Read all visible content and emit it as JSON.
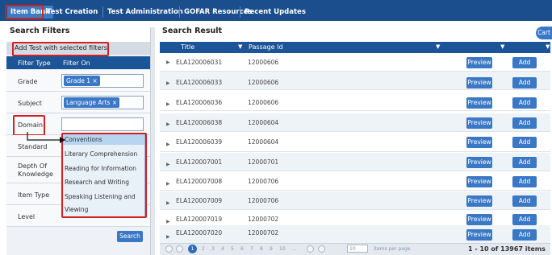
{
  "nav": {
    "items": [
      {
        "label": "Item Bank"
      },
      {
        "label": "Test Creation"
      },
      {
        "label": "Test Administration"
      },
      {
        "label": "GOFAR Resources"
      },
      {
        "label": "Recent Updates"
      }
    ]
  },
  "filters": {
    "title": "Search Filters",
    "add_test_label": "Add Test with selected filters",
    "col_filter_type": "Filter Type",
    "col_filter_on": "Filter On",
    "rows": [
      {
        "label": "Grade",
        "chip": "Grade 1 ×"
      },
      {
        "label": "Subject",
        "chip": "Language Arts ×"
      },
      {
        "label": "Domain"
      },
      {
        "label": "Standard"
      },
      {
        "label": "Depth Of Knowledge"
      },
      {
        "label": "Item Type"
      },
      {
        "label": "Level"
      }
    ],
    "domain_options": [
      "Conventions",
      "Literary Comprehension",
      "Reading for Information",
      "Research and Writing",
      "Speaking Listening and",
      "Viewing"
    ],
    "search_label": "Search"
  },
  "results": {
    "title": "Search Result",
    "cart_label": "Cart",
    "col_title": "Title",
    "col_passage": "Passage Id",
    "preview_label": "Preview",
    "add_label": "Add",
    "rows": [
      {
        "title": "ELA120006031",
        "passage": "12000606"
      },
      {
        "title": "ELA120006033",
        "passage": "12000606"
      },
      {
        "title": "ELA120006036",
        "passage": "12000606"
      },
      {
        "title": "ELA120006038",
        "passage": "12000604"
      },
      {
        "title": "ELA120006039",
        "passage": "12000604"
      },
      {
        "title": "ELA120007001",
        "passage": "12000701"
      },
      {
        "title": "ELA120007008",
        "passage": "12000706"
      },
      {
        "title": "ELA120007009",
        "passage": "12000706"
      },
      {
        "title": "ELA120007019",
        "passage": "12000702"
      },
      {
        "title": "ELA120007020",
        "passage": "12000702"
      }
    ]
  },
  "pager": {
    "pages": [
      "1",
      "2",
      "3",
      "4",
      "5",
      "6",
      "7",
      "8",
      "9",
      "10",
      "..."
    ],
    "page_size": "10",
    "items_per_page_label": "items per page",
    "summary": "1 - 10 of 13967 items"
  }
}
